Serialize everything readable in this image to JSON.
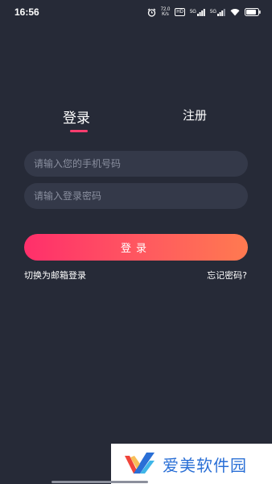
{
  "status_bar": {
    "time": "16:56",
    "net_speed_value": "72.0",
    "net_speed_unit": "K/s",
    "hd_label": "HD",
    "signal1_label": "5G",
    "signal2_label": "5G",
    "battery_level": "80%"
  },
  "tabs": {
    "login": "登录",
    "register": "注册",
    "active": "login"
  },
  "form": {
    "phone_placeholder": "请输入您的手机号码",
    "password_placeholder": "请输入登录密码",
    "submit_label": "登录"
  },
  "links": {
    "switch_email": "切换为邮箱登录",
    "forgot_password": "忘记密码?"
  },
  "watermark": {
    "text": "爱美软件园",
    "color": "#2a6fd6"
  },
  "colors": {
    "background": "#262a37",
    "input_bg": "#343949",
    "accent": "#ff3d6e",
    "button_gradient_start": "#ff2f6b",
    "button_gradient_end": "#ff7a50"
  }
}
